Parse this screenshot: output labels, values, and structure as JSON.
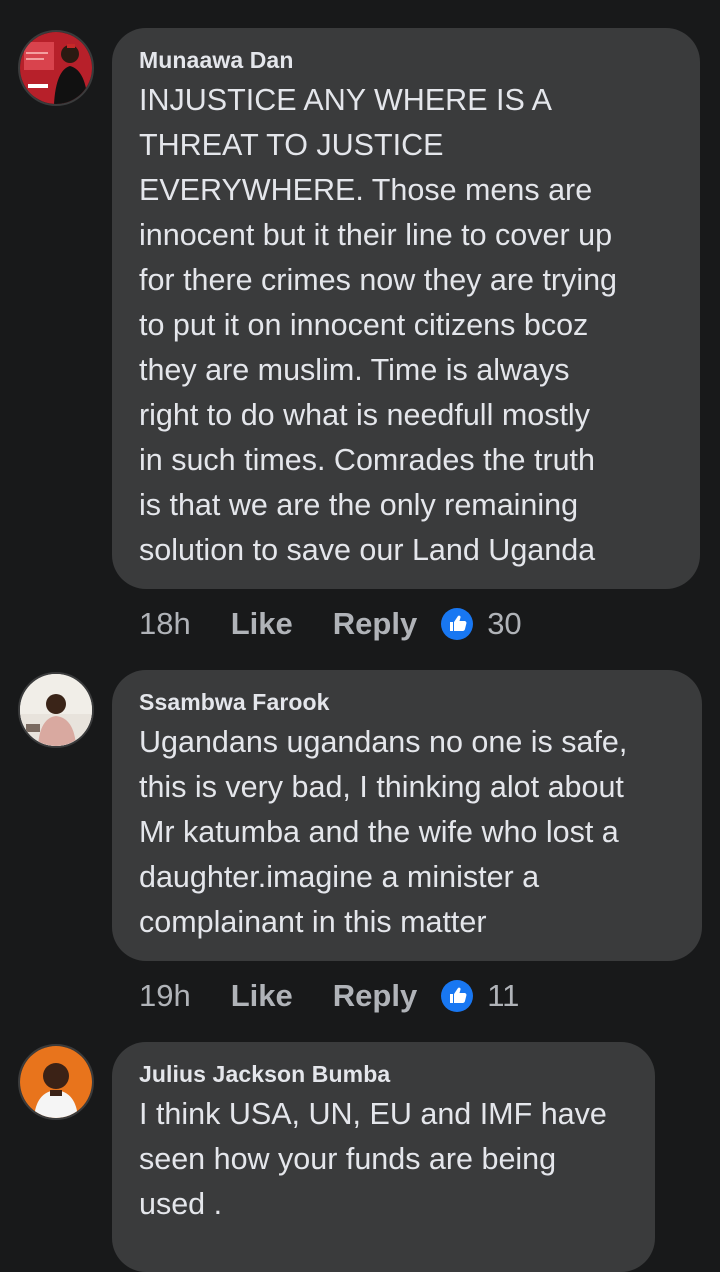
{
  "comments": [
    {
      "author": "Munaawa Dan",
      "text": "INJUSTICE ANY WHERE IS A\nTHREAT TO JUSTICE\nEVERYWHERE. Those mens are\ninnocent but it their line to cover up\nfor there crimes now they are trying\nto put it on innocent citizens bcoz\nthey are muslim. Time is always\nright to do what is needfull mostly\nin such times. Comrades the truth\nis that we are the only remaining\nsolution to save our Land Uganda",
      "time": "18h",
      "like_label": "Like",
      "reply_label": "Reply",
      "reaction_icon": "thumbs-up-icon",
      "reaction_count": "30"
    },
    {
      "author": "Ssambwa Farook",
      "text": "Ugandans ugandans no one is safe,\nthis is very bad, I thinking alot about\nMr katumba and the wife who lost a\ndaughter.imagine a minister a\ncomplainant in this matter",
      "time": "19h",
      "like_label": "Like",
      "reply_label": "Reply",
      "reaction_icon": "thumbs-up-icon",
      "reaction_count": "11"
    },
    {
      "author": "Julius Jackson Bumba",
      "text": "I think USA, UN, EU and IMF have\nseen how your funds are being\nused .",
      "time": "",
      "like_label": "",
      "reply_label": "",
      "reaction_icon": "",
      "reaction_count": ""
    }
  ],
  "colors": {
    "background": "#18191a",
    "bubble": "#3a3b3c",
    "text": "#e4e6eb",
    "muted": "#b0b3b8",
    "reaction_blue": "#1877f2"
  }
}
